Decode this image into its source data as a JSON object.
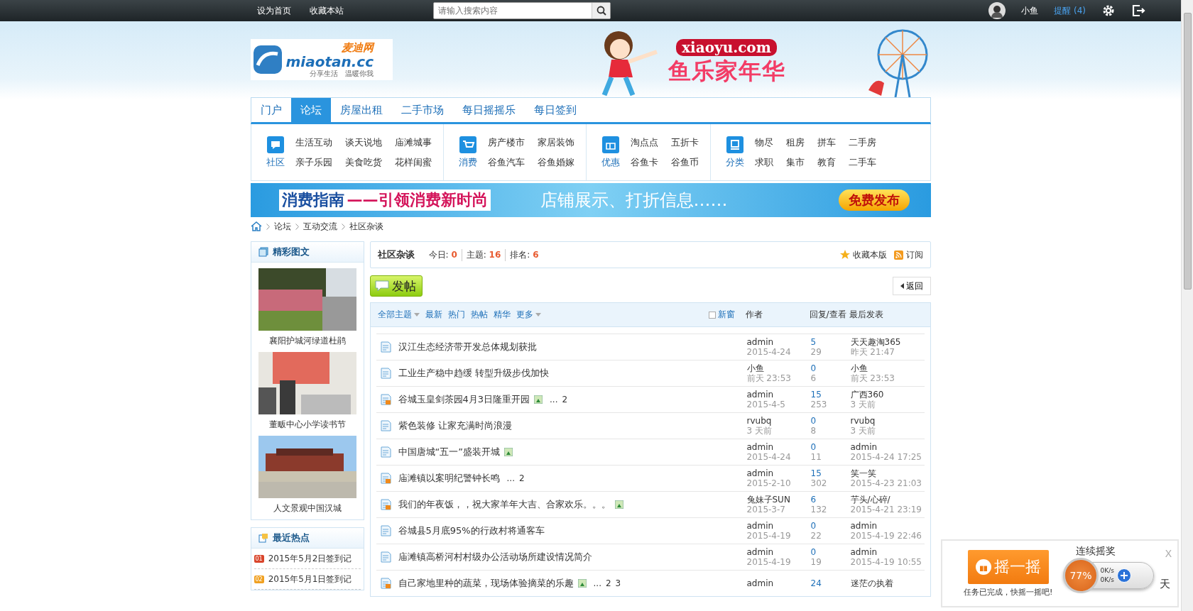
{
  "top_bar": {
    "links": [
      "设为首页",
      "收藏本站"
    ],
    "search": {
      "placeholder": "请输入搜索内容"
    },
    "user": "小鱼",
    "reminder": {
      "label": "提醒",
      "count": "(4)"
    }
  },
  "header": {
    "logo": {
      "cn": "麦迪网",
      "domain": "miaotan.cc",
      "slogan": "分享生活　温暖你我"
    },
    "banner": {
      "domain": "xiaoyu.com",
      "title": "鱼乐家年华"
    }
  },
  "nav": {
    "tabs": [
      {
        "label": "门户",
        "selected": false
      },
      {
        "label": "论坛",
        "selected": true
      },
      {
        "label": "房屋出租",
        "selected": false
      },
      {
        "label": "二手市场",
        "selected": false
      },
      {
        "label": "每日摇摇乐",
        "selected": false
      },
      {
        "label": "每日签到",
        "selected": false
      }
    ]
  },
  "categories": [
    {
      "label": "社区",
      "kind": "chat",
      "links": [
        "生活互动",
        "谈天说地",
        "庙滩城事",
        "亲子乐园",
        "美食吃货",
        "花样闺蜜"
      ]
    },
    {
      "label": "消费",
      "kind": "cart",
      "links": [
        "房产楼市",
        "家居装饰",
        "谷鱼汽车",
        "谷鱼婚嫁"
      ]
    },
    {
      "label": "优惠",
      "kind": "gift",
      "links": [
        "淘点点",
        "五折卡",
        "谷鱼卡",
        "谷鱼币"
      ]
    },
    {
      "label": "分类",
      "kind": "board",
      "links": [
        "物尽",
        "租房",
        "拼车",
        "二手房",
        "求职",
        "集市",
        "教育",
        "二手车"
      ]
    }
  ],
  "promo": {
    "title": "消费指南",
    "subtitle": "——引领消费新时尚",
    "text": "店铺展示、打折信息……",
    "button": "免费发布"
  },
  "breadcrumb": [
    "论坛",
    "互动交流",
    "社区杂谈"
  ],
  "sidebar": {
    "featured": {
      "title": "精彩图文",
      "items": [
        {
          "caption": "襄阳护城河绿道杜鹃",
          "kind": "picture"
        },
        {
          "caption": "董畈中心小学读书节",
          "kind": "picture"
        },
        {
          "caption": "人文景观中国汉城",
          "kind": "picture"
        }
      ]
    },
    "hot": {
      "title": "最近热点",
      "items": [
        {
          "num": "01",
          "label": "2015年5月2日签到记",
          "color": "#d9452b"
        },
        {
          "num": "02",
          "label": "2015年5月1日签到记",
          "color": "#f0a020"
        }
      ]
    }
  },
  "forum": {
    "name": "社区杂谈",
    "stats": [
      {
        "label": "今日:",
        "value": "0"
      },
      {
        "label": "主题:",
        "value": "16"
      },
      {
        "label": "排名:",
        "value": "6"
      }
    ],
    "favorite": "收藏本版",
    "subscribe": "订阅",
    "post_button": "发帖",
    "back_button": "返回"
  },
  "filters": [
    {
      "label": "全部主题",
      "dropdown": true
    },
    {
      "label": "最新",
      "dropdown": false
    },
    {
      "label": "热门",
      "dropdown": false
    },
    {
      "label": "热帖",
      "dropdown": false
    },
    {
      "label": "精华",
      "dropdown": false
    },
    {
      "label": "更多",
      "dropdown": true
    }
  ],
  "new_window": {
    "label": "新窗",
    "checked": false
  },
  "columns": [
    "作者",
    "回复/查看",
    "最后发表"
  ],
  "threads": [
    {
      "hot": false,
      "title": "汉江生态经济带开发总体规划获批",
      "image": false,
      "author": "admin",
      "date": "2015-4-24",
      "replies": "5",
      "views": "29",
      "last_user": "天天趣淘365",
      "last_time": "昨天 21:47"
    },
    {
      "hot": false,
      "title": "工业生产稳中趋缓 转型升级步伐加快",
      "image": false,
      "author": "小鱼",
      "date": "前天 23:53",
      "replies": "0",
      "views": "6",
      "last_user": "小鱼",
      "last_time": "前天 23:53"
    },
    {
      "hot": true,
      "title": "谷城玉皇剑茶园4月3日隆重开园",
      "image": true,
      "more": "...",
      "pages": [
        "2"
      ],
      "author": "admin",
      "date": "2015-4-5",
      "replies": "15",
      "views": "253",
      "last_user": "广西360",
      "last_time": "3 天前"
    },
    {
      "hot": false,
      "title": "紫色装修 让家充满时尚浪漫",
      "image": false,
      "author": "rvubq",
      "date": "3 天前",
      "replies": "0",
      "views": "8",
      "last_user": "rvubq",
      "last_time": "3 天前"
    },
    {
      "hot": false,
      "title": "中国唐城“五一”盛装开城",
      "image": true,
      "author": "admin",
      "date": "2015-4-24",
      "replies": "0",
      "views": "11",
      "last_user": "admin",
      "last_time": "2015-4-24 17:25"
    },
    {
      "hot": true,
      "title": "庙滩镇以案明纪警钟长鸣",
      "image": false,
      "more": "...",
      "pages": [
        "2"
      ],
      "author": "admin",
      "date": "2015-2-10",
      "replies": "15",
      "views": "302",
      "last_user": "笑一笑",
      "last_time": "2015-4-23 21:03"
    },
    {
      "hot": true,
      "title": "我们的年夜饭，，祝大家羊年大吉、合家欢乐。。。",
      "image": true,
      "author": "兔妹子SUN",
      "date": "2015-3-7",
      "replies": "6",
      "views": "132",
      "last_user": "芋头/心碎/",
      "last_time": "2015-4-21 23:19"
    },
    {
      "hot": false,
      "title": "谷城县5月底95%的行政村将通客车",
      "image": false,
      "author": "admin",
      "date": "2015-4-19",
      "replies": "0",
      "views": "22",
      "last_user": "admin",
      "last_time": "2015-4-19 22:46"
    },
    {
      "hot": false,
      "title": "庙滩镇高桥河村村级办公活动场所建设情况简介",
      "image": false,
      "author": "admin",
      "date": "2015-4-19",
      "replies": "0",
      "views": "19",
      "last_user": "admin",
      "last_time": "2015-4-19 10:55"
    },
    {
      "hot": true,
      "title": "自己家地里种的蔬菜，现场体验摘菜的乐趣",
      "image": true,
      "more": "...",
      "pages": [
        "2",
        "3"
      ],
      "author": "admin",
      "replies": "24",
      "last_user": "迷茫の执着"
    }
  ],
  "popup": {
    "button": "摇一摇",
    "message": "任务已完成，快摇一摇吧!",
    "title": "连续摇奖",
    "close": "X",
    "trailing": "天"
  },
  "speed_widget": {
    "percent": "77%",
    "up": "0K/s",
    "down": "0K/s"
  }
}
